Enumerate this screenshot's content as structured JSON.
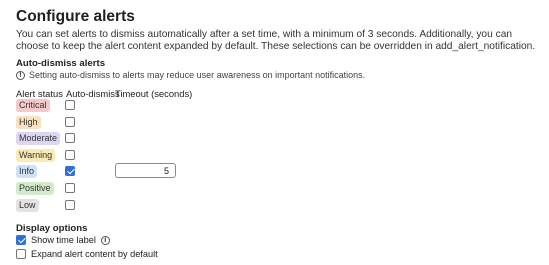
{
  "page": {
    "title": "Configure alerts",
    "description": "You can set alerts to dismiss automatically after a set time, with a minimum of 3 seconds. Additionally, you can choose to keep the alert content expanded by default. These selections can be overridden in add_alert_notification."
  },
  "auto_dismiss": {
    "heading": "Auto-dismiss alerts",
    "note": "Setting auto-dismiss to alerts may reduce user awareness on important notifications.",
    "columns": {
      "status": "Alert status",
      "auto": "Auto-dismiss",
      "timeout": "Timeout (seconds)"
    },
    "rows": [
      {
        "label": "Critical",
        "color": "#f6c9cc",
        "checked": false
      },
      {
        "label": "High",
        "color": "#fbe0bf",
        "checked": false
      },
      {
        "label": "Moderate",
        "color": "#dcd6f3",
        "checked": false
      },
      {
        "label": "Warning",
        "color": "#fbeab3",
        "checked": false
      },
      {
        "label": "Info",
        "color": "#cfe2f7",
        "checked": true,
        "timeout": "5"
      },
      {
        "label": "Positive",
        "color": "#d4ebcb",
        "checked": false
      },
      {
        "label": "Low",
        "color": "#e2e2e2",
        "checked": false
      }
    ]
  },
  "display": {
    "heading": "Display options",
    "show_time_label": "Show time label",
    "show_time_checked": true,
    "expand_label": "Expand alert content by default",
    "expand_checked": false
  }
}
